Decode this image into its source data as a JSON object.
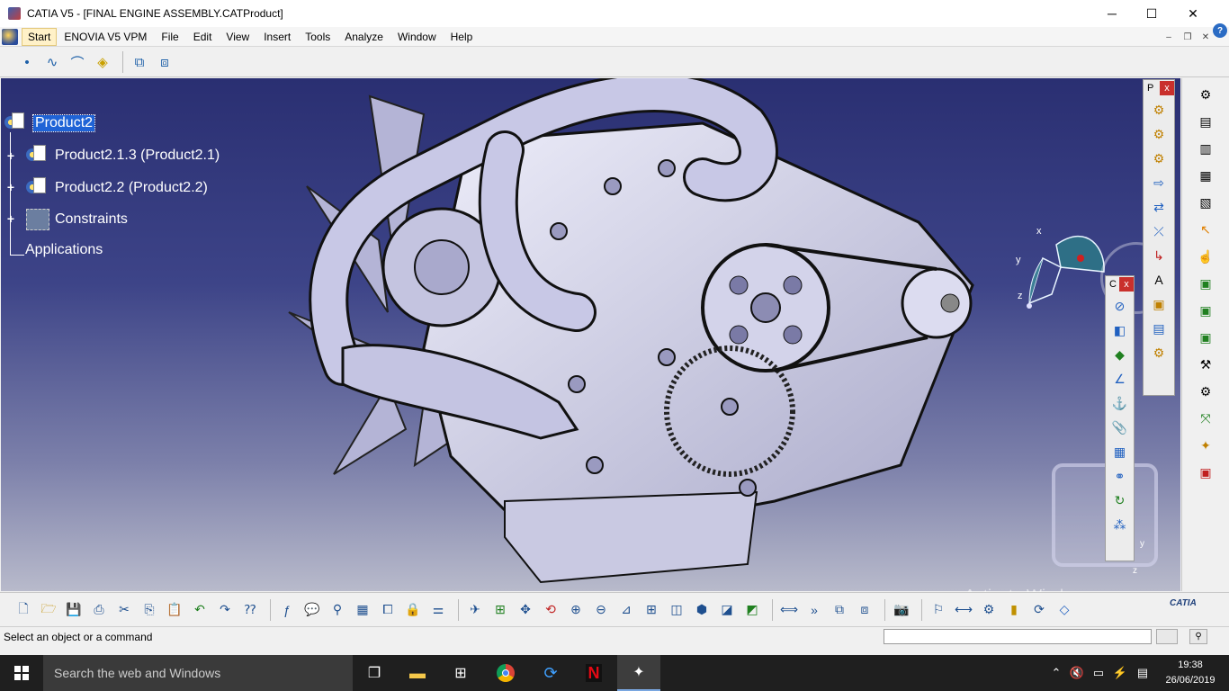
{
  "window": {
    "title": "CATIA V5 - [FINAL ENGINE ASSEMBLY.CATProduct]",
    "minimize": "─",
    "maximize": "☐",
    "close": "✕"
  },
  "menu": {
    "items": [
      "Start",
      "ENOVIA V5 VPM",
      "File",
      "Edit",
      "View",
      "Insert",
      "Tools",
      "Analyze",
      "Window",
      "Help"
    ]
  },
  "mdi": {
    "minimize": "–",
    "restore": "❐",
    "close": "✕",
    "help": "?"
  },
  "tree": {
    "root": "Product2",
    "children": [
      "Product2.1.3 (Product2.1)",
      "Product2.2 (Product2.2)",
      "Constraints"
    ],
    "applications": "Applications"
  },
  "compass": {
    "x_label": "x",
    "y_label": "y",
    "z_label": "z"
  },
  "floating_toolbars": {
    "product_structure": {
      "title": "P",
      "close": "x"
    },
    "constraints": {
      "title": "C",
      "close": "x"
    }
  },
  "axis_indicator": {
    "y_label": "y",
    "z_label": "z"
  },
  "status": {
    "text": "Select an object or a command",
    "command_input_value": ""
  },
  "watermark": {
    "line1": "Activate Windows"
  },
  "taskbar": {
    "search_placeholder": "Search the web and Windows",
    "time": "19:38",
    "date": "26/06/2019"
  },
  "brand": {
    "catia_label": "CATIA"
  },
  "colors": {
    "viewport_top": "#2a2f72",
    "viewport_bottom": "#b8bacb",
    "selection": "#1f63d6",
    "close_red": "#c9302c"
  }
}
